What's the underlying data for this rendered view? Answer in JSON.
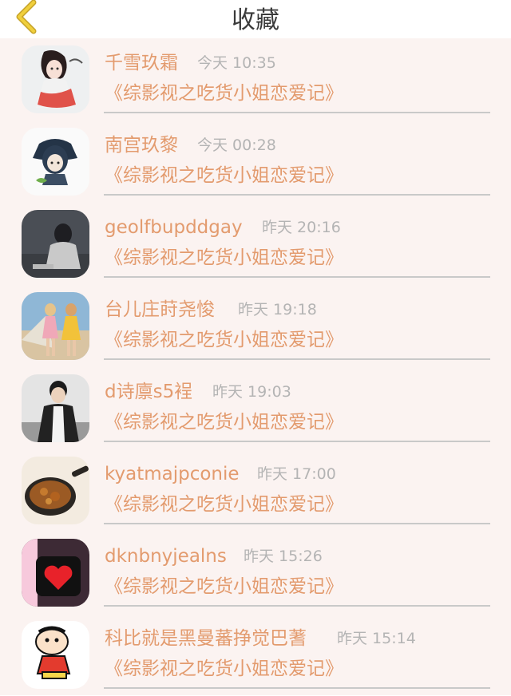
{
  "nav": {
    "title": "收藏",
    "back_icon": "chevron-left-icon",
    "back_color": "#e9c532"
  },
  "favorites": [
    {
      "user": "千雪玖霜",
      "time": "今天 10:35",
      "book": "《综影视之吃货小姐恋爱记》",
      "avatar": "anime-girl-avatar"
    },
    {
      "user": "南宫玖黎",
      "time": "今天 00:28",
      "book": "《综影视之吃货小姐恋爱记》",
      "avatar": "hooded-cartoon-avatar"
    },
    {
      "user": "geolfbupddgay",
      "time": "昨天 20:16",
      "book": "《综影视之吃货小姐恋爱记》",
      "avatar": "grey-photo-avatar"
    },
    {
      "user": "台儿庄莳尧悛",
      "time": "昨天 19:18",
      "book": "《综影视之吃货小姐恋爱记》",
      "avatar": "two-girls-avatar"
    },
    {
      "user": "d诗廪s5裎",
      "time": "昨天 19:03",
      "book": "《综影视之吃货小姐恋爱记》",
      "avatar": "young-man-avatar"
    },
    {
      "user": "kyatmajpconie",
      "time": "昨天 17:00",
      "book": "《综影视之吃货小姐恋爱记》",
      "avatar": "food-pan-avatar"
    },
    {
      "user": "dknbnyjealns",
      "time": "昨天 15:26",
      "book": "《综影视之吃货小姐恋爱记》",
      "avatar": "heart-frame-avatar"
    },
    {
      "user": "科比就是黑曼蕃挣觉巴蓍",
      "time": "昨天 15:14",
      "book": "《综影视之吃货小姐恋爱记》",
      "avatar": "crayon-boy-avatar"
    }
  ],
  "colors": {
    "accent": "#e39b6e",
    "time": "#b4b4b4",
    "background": "#fbf3f1",
    "separator": "#c9c9c9"
  }
}
